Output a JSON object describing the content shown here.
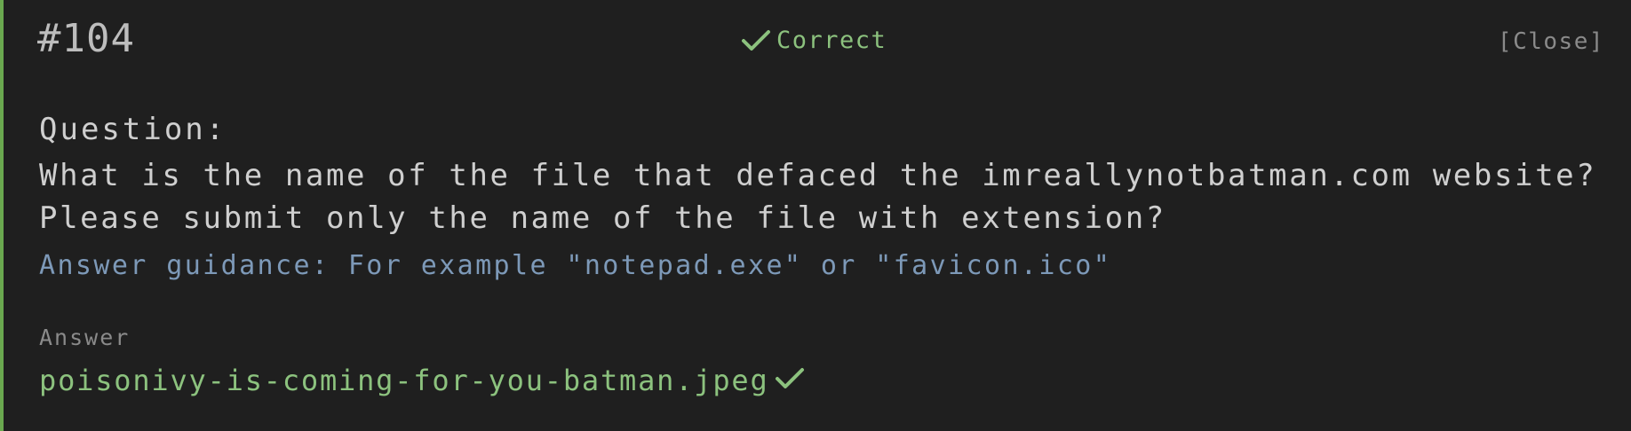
{
  "question_number": "#104",
  "status": {
    "label": "Correct",
    "icon": "checkmark-icon",
    "color": "#8cc27e"
  },
  "close_label": "[Close]",
  "question": {
    "label": "Question:",
    "text": "What is the name of the file that defaced the imreallynotbatman.com website? Please submit only the name of the file with extension?",
    "guidance": "Answer guidance: For example \"notepad.exe\" or \"favicon.ico\""
  },
  "answer": {
    "label": "Answer",
    "value": "poisonivy-is-coming-for-you-batman.jpeg",
    "icon": "checkmark-icon"
  },
  "colors": {
    "accent_border": "#6aa84f",
    "background": "#1f1f1f",
    "guidance": "#7d99b8"
  }
}
